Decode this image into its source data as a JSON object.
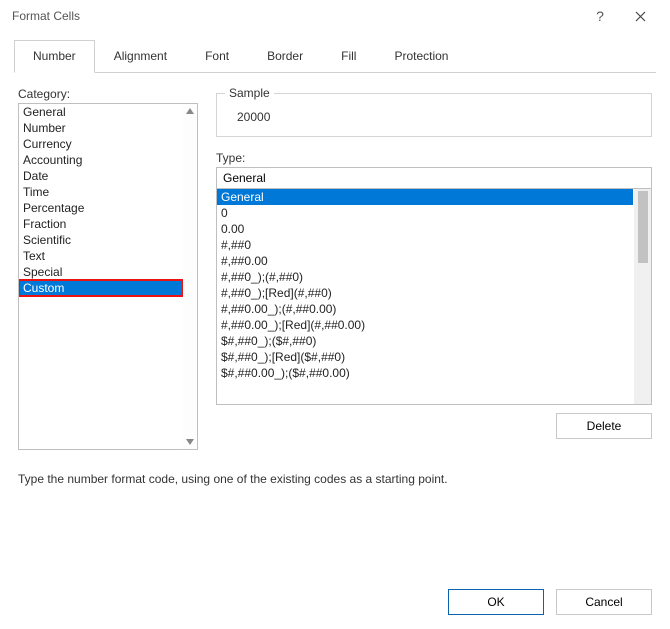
{
  "window": {
    "title": "Format Cells"
  },
  "tabs": {
    "number": "Number",
    "alignment": "Alignment",
    "font": "Font",
    "border": "Border",
    "fill": "Fill",
    "protection": "Protection"
  },
  "labels": {
    "category": "Category:",
    "sample": "Sample",
    "type": "Type:",
    "delete": "Delete",
    "ok": "OK",
    "cancel": "Cancel"
  },
  "categories": [
    "General",
    "Number",
    "Currency",
    "Accounting",
    "Date",
    "Time",
    "Percentage",
    "Fraction",
    "Scientific",
    "Text",
    "Special",
    "Custom"
  ],
  "selected_category_index": 11,
  "sample_value": "20000",
  "type_value": "General",
  "type_list": [
    "General",
    "0",
    "0.00",
    "#,##0",
    "#,##0.00",
    "#,##0_);(#,##0)",
    "#,##0_);[Red](#,##0)",
    "#,##0.00_);(#,##0.00)",
    "#,##0.00_);[Red](#,##0.00)",
    "$#,##0_);($#,##0)",
    "$#,##0_);[Red]($#,##0)",
    "$#,##0.00_);($#,##0.00)"
  ],
  "selected_type_index": 0,
  "hint": "Type the number format code, using one of the existing codes as a starting point."
}
